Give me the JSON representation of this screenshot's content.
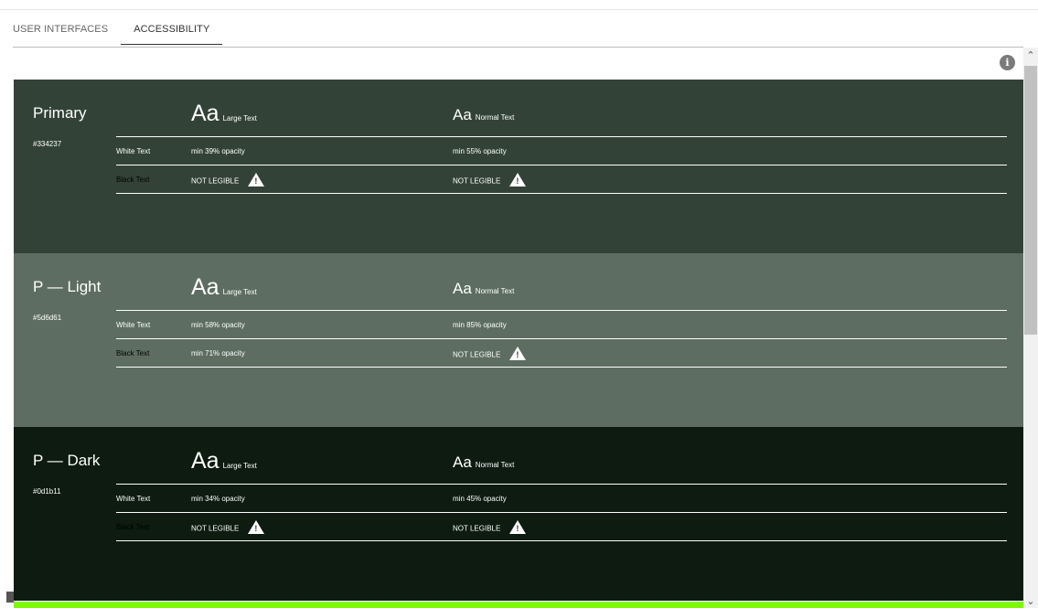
{
  "tabs": [
    "USER INTERFACES",
    "ACCESSIBILITY"
  ],
  "labels": {
    "large_text": "Large Text",
    "normal_text": "Normal Text",
    "aa": "Aa",
    "white_text": "White Text",
    "black_text": "Black Text"
  },
  "panels": [
    {
      "name": "Primary",
      "hex": "#334237",
      "bg": "#334237",
      "white": {
        "large": "min 39% opacity",
        "normal": "min 55% opacity"
      },
      "black": {
        "large": "NOT LEGIBLE",
        "normal": "NOT LEGIBLE"
      }
    },
    {
      "name": "P — Light",
      "hex": "#5d6d61",
      "bg": "#5d6d61",
      "white": {
        "large": "min 58% opacity",
        "normal": "min 85% opacity"
      },
      "black": {
        "large": "min 71% opacity",
        "normal": "NOT LEGIBLE"
      }
    },
    {
      "name": "P — Dark",
      "hex": "#0d1b11",
      "bg": "#0d1b11",
      "white": {
        "large": "min 34% opacity",
        "normal": "min 45% opacity"
      },
      "black": {
        "large": "NOT LEGIBLE",
        "normal": "NOT LEGIBLE"
      }
    }
  ],
  "colors": {
    "progress": "#76ff03"
  },
  "icons": {
    "info": "info-icon",
    "warning": "warning-icon"
  }
}
